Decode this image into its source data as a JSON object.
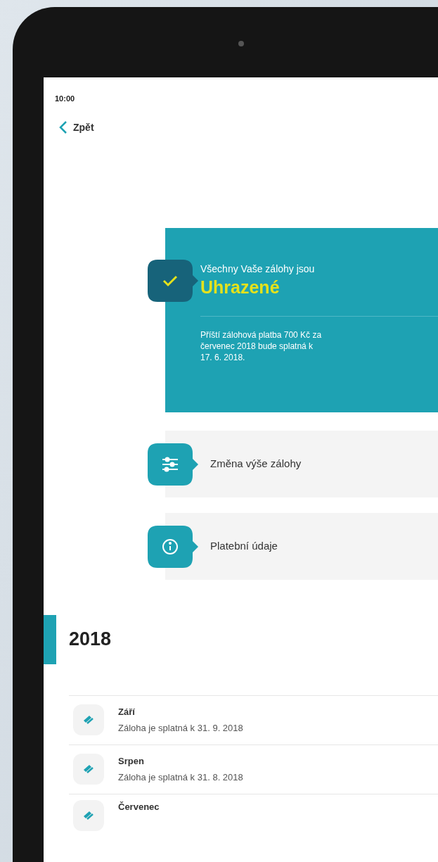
{
  "status_bar": {
    "time": "10:00"
  },
  "back_link": {
    "label": "Zpět"
  },
  "status_card": {
    "intro": "Všechny Vaše zálohy jsou",
    "status": "Uhrazené",
    "note": "Příští zálohová platba 700 Kč za červenec 2018 bude splatná k 17. 6. 2018."
  },
  "actions": [
    {
      "kind": "sliders",
      "label": "Změna výše zálohy"
    },
    {
      "kind": "info",
      "label": "Platební údaje"
    }
  ],
  "year": {
    "label": "2018"
  },
  "payments": [
    {
      "month": "Září",
      "due": "Záloha je splatná k 31. 9. 2018"
    },
    {
      "month": "Srpen",
      "due": "Záloha je splatná k 31. 8. 2018"
    },
    {
      "month": "Červenec"
    }
  ]
}
